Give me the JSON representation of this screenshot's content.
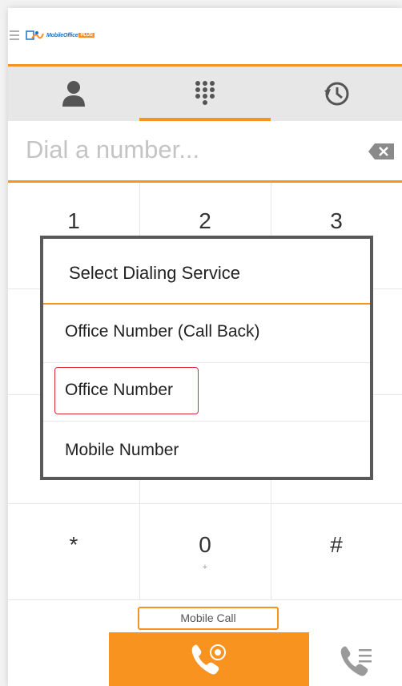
{
  "app": {
    "logo_text": "MobileOffice",
    "logo_plus": "PLUS"
  },
  "tabs": [
    {
      "name": "contacts",
      "icon": "person-icon",
      "active": false
    },
    {
      "name": "dialpad",
      "icon": "dialpad-icon",
      "active": true
    },
    {
      "name": "history",
      "icon": "clock-history-icon",
      "active": false
    }
  ],
  "dial": {
    "placeholder": "Dial a number..."
  },
  "keypad": {
    "keys": [
      {
        "digit": "1",
        "sub": ""
      },
      {
        "digit": "2",
        "sub": ""
      },
      {
        "digit": "3",
        "sub": ""
      },
      {
        "digit": "*",
        "sub": ""
      },
      {
        "digit": "0",
        "sub": "+"
      },
      {
        "digit": "#",
        "sub": ""
      }
    ]
  },
  "dialog": {
    "title": "Select Dialing Service",
    "options": [
      {
        "label": "Office Number (Call Back)"
      },
      {
        "label": "Office Number",
        "highlighted": true
      },
      {
        "label": "Mobile Number"
      }
    ]
  },
  "footer": {
    "mobile_call_label": "Mobile Call"
  },
  "colors": {
    "accent": "#f7931e",
    "highlight": "#d9283a",
    "dialog_border": "#595959"
  }
}
